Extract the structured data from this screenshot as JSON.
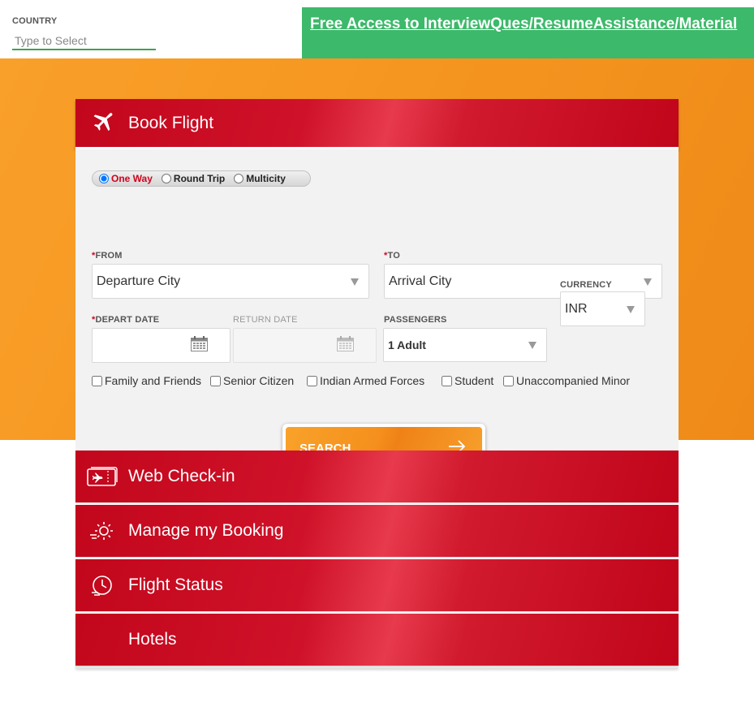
{
  "country": {
    "label": "COUNTRY",
    "placeholder": "Type to Select"
  },
  "promo": {
    "text": "Free Access to InterviewQues/ResumeAssistance/Material"
  },
  "book": {
    "title": "Book Flight",
    "trip_types": [
      "One Way",
      "Round Trip",
      "Multicity"
    ],
    "selected_trip": "One Way",
    "from": {
      "label": "FROM",
      "value": "Departure City"
    },
    "to": {
      "label": "TO",
      "value": "Arrival City"
    },
    "currency": {
      "label": "CURRENCY",
      "value": "INR"
    },
    "depart_date": {
      "label": "DEPART DATE",
      "value": ""
    },
    "return_date": {
      "label": "RETURN DATE",
      "value": ""
    },
    "passengers": {
      "label": "PASSENGERS",
      "value": "1 Adult"
    },
    "options": [
      "Family and Friends",
      "Senior Citizen",
      "Indian Armed Forces",
      "Student",
      "Unaccompanied Minor"
    ],
    "search_label": "SEARCH"
  },
  "sections": [
    {
      "label": "Web Check-in",
      "icon": "boarding-pass-icon"
    },
    {
      "label": "Manage my Booking",
      "icon": "gear-plane-icon"
    },
    {
      "label": "Flight Status",
      "icon": "clock-plane-icon"
    },
    {
      "label": "Hotels",
      "icon": ""
    }
  ],
  "colors": {
    "red": "#c2061b",
    "orange": "#f59620",
    "green": "#3cb96a"
  }
}
